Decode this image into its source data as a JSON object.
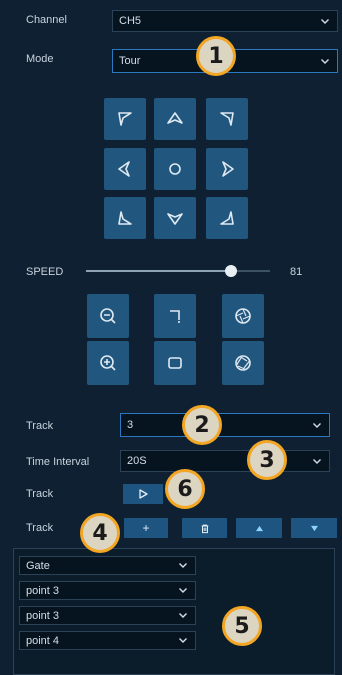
{
  "channel": {
    "label": "Channel",
    "value": "CH5"
  },
  "mode": {
    "label": "Mode",
    "value": "Tour"
  },
  "speed": {
    "label": "SPEED",
    "value": "81",
    "level_fraction": 0.81
  },
  "track1": {
    "label": "Track",
    "value": "3"
  },
  "time_interval": {
    "label": "Time Interval",
    "value": "20S"
  },
  "track2": {
    "label": "Track"
  },
  "track3": {
    "label": "Track",
    "add_label": "+",
    "delete_icon": "trash-icon",
    "up_icon": "triangle-up-icon",
    "down_icon": "triangle-down-icon"
  },
  "points": [
    "Gate",
    "point 3",
    "point 3",
    "point 4"
  ],
  "badges": [
    "1",
    "2",
    "3",
    "4",
    "5",
    "6"
  ],
  "colors": {
    "background": "#0e2031",
    "button": "#21577e",
    "badge_ring": "#f3a623",
    "badge_fill": "#dcd5c2"
  }
}
